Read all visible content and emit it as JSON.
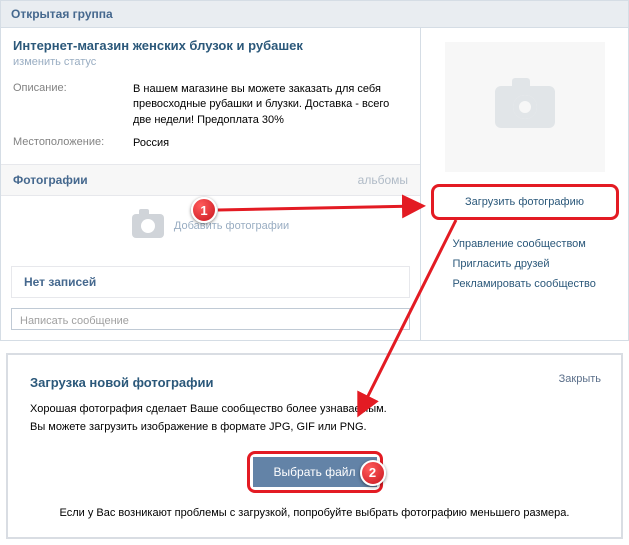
{
  "header": {
    "title": "Открытая группа"
  },
  "group": {
    "title": "Интернет-магазин женских блузок и рубашек",
    "change_status": "изменить статус",
    "description_label": "Описание:",
    "description_value": "В нашем магазине вы можете заказать для себя превосходные рубашки и блузки. Доставка - всего две недели! Предоплата 30%",
    "location_label": "Местоположение:",
    "location_value": "Россия"
  },
  "photos": {
    "section_title": "Фотографии",
    "albums_link": "альбомы",
    "add_label": "Добавить фотографии"
  },
  "feed": {
    "empty_title": "Нет записей",
    "write_placeholder": "Написать сообщение"
  },
  "sidebar": {
    "upload_button": "Загрузить фотографию",
    "links": [
      "Управление сообществом",
      "Пригласить друзей",
      "Рекламировать сообщество"
    ]
  },
  "modal": {
    "title": "Загрузка новой фотографии",
    "close": "Закрыть",
    "line1": "Хорошая фотография сделает Ваше сообщество более узнаваемым.",
    "line2": "Вы можете загрузить изображение в формате JPG, GIF или PNG.",
    "file_button": "Выбрать файл",
    "footer": "Если у Вас возникают проблемы с загрузкой, попробуйте выбрать фотографию меньшего размера."
  },
  "badges": {
    "b1": "1",
    "b2": "2"
  }
}
